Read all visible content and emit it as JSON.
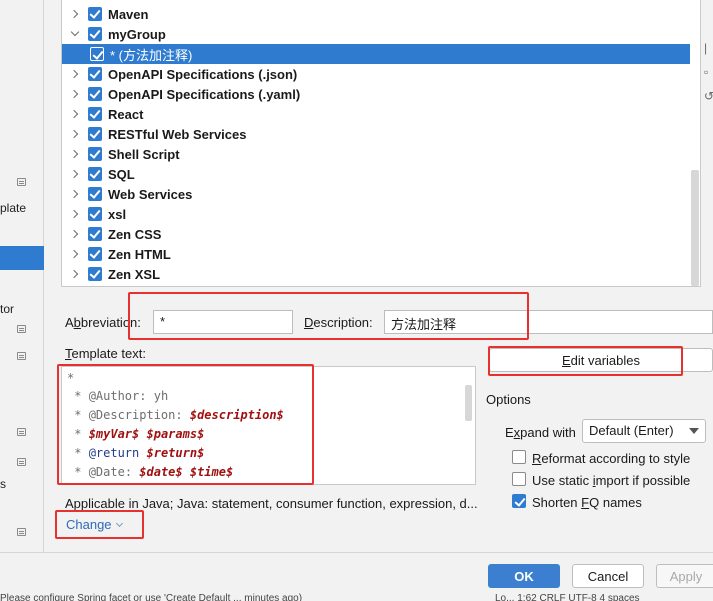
{
  "sidebar": {
    "labels": [
      "plate",
      "tor",
      "s"
    ]
  },
  "tree": {
    "items": [
      {
        "label": "Maven",
        "expanded": false,
        "checked": true
      },
      {
        "label": "myGroup",
        "expanded": true,
        "checked": true
      },
      {
        "label": "* (方法加注释)",
        "child": true,
        "selected": true,
        "checked": true
      },
      {
        "label": "OpenAPI Specifications (.json)",
        "expanded": false,
        "checked": true
      },
      {
        "label": "OpenAPI Specifications (.yaml)",
        "expanded": false,
        "checked": true
      },
      {
        "label": "React",
        "expanded": false,
        "checked": true
      },
      {
        "label": "RESTful Web Services",
        "expanded": false,
        "checked": true
      },
      {
        "label": "Shell Script",
        "expanded": false,
        "checked": true
      },
      {
        "label": "SQL",
        "expanded": false,
        "checked": true
      },
      {
        "label": "Web Services",
        "expanded": false,
        "checked": true
      },
      {
        "label": "xsl",
        "expanded": false,
        "checked": true
      },
      {
        "label": "Zen CSS",
        "expanded": false,
        "checked": true
      },
      {
        "label": "Zen HTML",
        "expanded": false,
        "checked": true
      },
      {
        "label": "Zen XSL",
        "expanded": false,
        "checked": true
      }
    ]
  },
  "form": {
    "abbreviation_label_pre": "A",
    "abbreviation_label_u": "b",
    "abbreviation_label_post": "breviation:",
    "abbreviation_value": "*",
    "description_label_u": "D",
    "description_label_post": "escription:",
    "description_value": "方法加注释",
    "template_label_u": "T",
    "template_label_post": "emplate text:",
    "edit_variables_pre": "",
    "edit_variables_u": "E",
    "edit_variables_post": "dit variables"
  },
  "template": {
    "lines": [
      [
        {
          "t": "*",
          "c": "plain"
        }
      ],
      [
        {
          "t": " * ",
          "c": "plain"
        },
        {
          "t": "@Author",
          "c": "tag"
        },
        {
          "t": ": yh",
          "c": "plain"
        }
      ],
      [
        {
          "t": " * ",
          "c": "plain"
        },
        {
          "t": "@Description",
          "c": "tag"
        },
        {
          "t": ": ",
          "c": "plain"
        },
        {
          "t": "$description$",
          "c": "var"
        }
      ],
      [
        {
          "t": " * ",
          "c": "plain"
        },
        {
          "t": "$myVar$",
          "c": "var"
        },
        {
          "t": " ",
          "c": "plain"
        },
        {
          "t": "$params$",
          "c": "var"
        }
      ],
      [
        {
          "t": " * ",
          "c": "plain"
        },
        {
          "t": "@return",
          "c": "kw"
        },
        {
          "t": " ",
          "c": "plain"
        },
        {
          "t": "$return$",
          "c": "var"
        }
      ],
      [
        {
          "t": " * ",
          "c": "plain"
        },
        {
          "t": "@Date",
          "c": "tag"
        },
        {
          "t": ": ",
          "c": "plain"
        },
        {
          "t": "$date$",
          "c": "var"
        },
        {
          "t": " ",
          "c": "plain"
        },
        {
          "t": "$time$",
          "c": "var"
        }
      ]
    ]
  },
  "applicable": {
    "text": "Applicable in Java; Java: statement, consumer function, expression, d...",
    "change_label": "Change"
  },
  "options": {
    "title": "Options",
    "expand_label_u": "x",
    "expand_label_pre": "E",
    "expand_label_post": "pand with",
    "expand_value": "Default (Enter)",
    "checks": [
      {
        "pre": "",
        "u": "R",
        "post": "eformat according to style",
        "checked": false
      },
      {
        "pre": "Use static ",
        "u": "i",
        "post": "mport if possible",
        "checked": false
      },
      {
        "pre": "Shorten ",
        "u": "F",
        "post": "Q names",
        "checked": true
      }
    ]
  },
  "footer": {
    "ok": "OK",
    "cancel": "Cancel",
    "apply": "Apply",
    "bottom_left": "Please configure Spring facet or use 'Create Default ... minutes ago)",
    "bottom_right": "Lo... 1:62 CRLF UTF-8 4 spaces"
  },
  "colors": {
    "accent": "#2f7bcf",
    "highlight": "#e8302e",
    "link": "#2f6bb8",
    "template_var": "#a01010"
  }
}
